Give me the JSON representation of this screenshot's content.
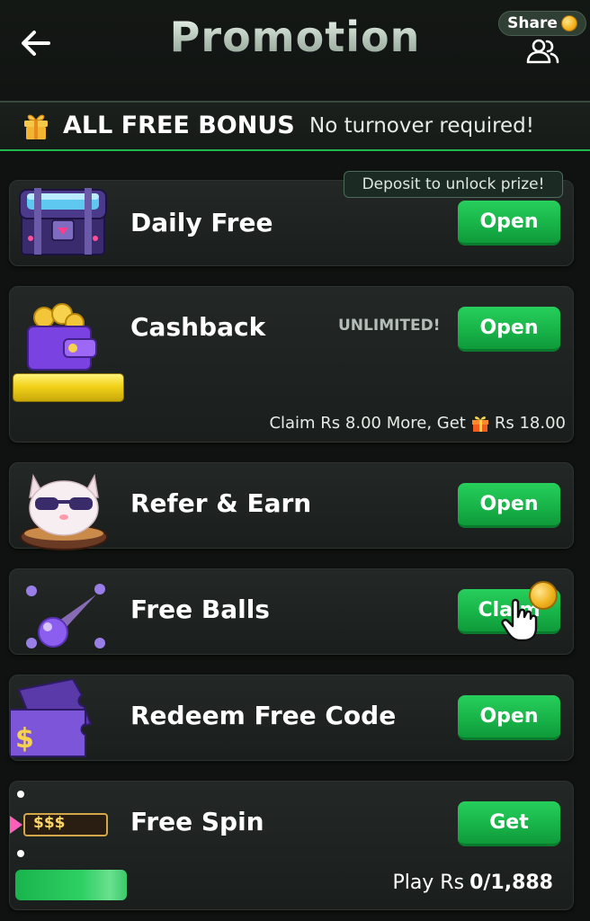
{
  "header": {
    "title": "Promotion",
    "share_label": "Share"
  },
  "bonus_banner": {
    "title": "ALL FREE BONUS",
    "subtitle": "No turnover required!"
  },
  "cards": {
    "daily_free": {
      "title": "Daily Free",
      "button": "Open",
      "note": "Deposit to unlock prize!"
    },
    "cashback": {
      "title": "Cashback",
      "tag": "UNLIMITED!",
      "button": "Open",
      "claim_prefix": "Claim Rs 8.00 More, Get",
      "claim_reward": "Rs 18.00"
    },
    "refer": {
      "title": "Refer & Earn",
      "button": "Open"
    },
    "free_balls": {
      "title": "Free Balls",
      "button": "Claim"
    },
    "redeem": {
      "title": "Redeem Free Code",
      "button": "Open"
    },
    "free_spin": {
      "title": "Free Spin",
      "button": "Get",
      "ticket_label": "$$$",
      "play_label": "Play Rs",
      "play_value": "0/1,888"
    }
  },
  "icons": {
    "back": "arrow-left-icon",
    "share": "users-icon",
    "gift": "gift-icon"
  },
  "colors": {
    "accent_green": "#1fb84c",
    "background": "#0f1210",
    "card": "#1f2421"
  }
}
